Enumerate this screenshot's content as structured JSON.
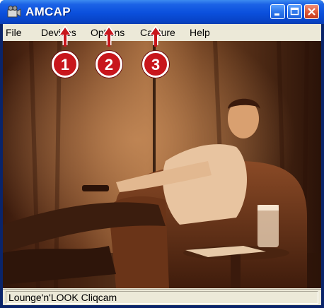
{
  "window": {
    "title": "AMCAP"
  },
  "menubar": {
    "items": [
      {
        "label": "File"
      },
      {
        "label": "Devices"
      },
      {
        "label": "Options"
      },
      {
        "label": "Capture"
      },
      {
        "label": "Help"
      }
    ]
  },
  "callouts": [
    {
      "number": "1"
    },
    {
      "number": "2"
    },
    {
      "number": "3"
    }
  ],
  "statusbar": {
    "text": "Lounge'n'LOOK Cliqcam"
  },
  "colors": {
    "titlebar": "#0a4fdc",
    "frame": "#ece9d8",
    "callout": "#c8161c",
    "sepia_dark": "#3a1a0c",
    "sepia_light": "#d8a47a"
  },
  "icons": [
    "app-camera-icon",
    "minimize-icon",
    "maximize-icon",
    "close-icon",
    "arrow-up-icon"
  ]
}
